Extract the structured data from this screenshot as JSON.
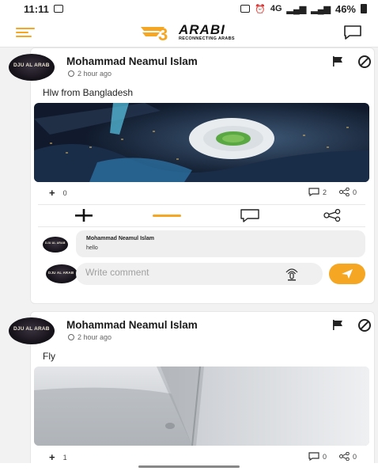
{
  "status_bar": {
    "time": "11:11",
    "battery": "46%",
    "network": "4G"
  },
  "header": {
    "brand": "ARABI",
    "tagline": "RECONNECTING ARABS"
  },
  "colors": {
    "accent": "#f5a623",
    "background": "#f2f2f2",
    "card": "#ffffff"
  },
  "posts": [
    {
      "avatar_text": "DJU AL ARAB",
      "author": "Mohammad Neamul Islam",
      "time": "2 hour ago",
      "text": "Hlw from Bangladesh",
      "image": "stadium aerial night",
      "likes": "0",
      "comments": "2",
      "shares": "0",
      "comment_list": [
        {
          "avatar_text": "DJU AL ARAB",
          "author": "Mohammad Neamul Islam",
          "text": "hello"
        }
      ],
      "write_placeholder": "Write comment"
    },
    {
      "avatar_text": "DJU AL ARAB",
      "author": "Mohammad Neamul Islam",
      "time": "2 hour ago",
      "text": "Fly",
      "image": "airplane wing sky",
      "likes": "1",
      "comments": "0",
      "shares": "0"
    }
  ],
  "icons": [
    "menu-icon",
    "chat-icon",
    "flag-icon",
    "block-icon",
    "clock-icon",
    "plus-icon",
    "comment-icon",
    "share-icon",
    "voice-icon",
    "send-icon"
  ]
}
